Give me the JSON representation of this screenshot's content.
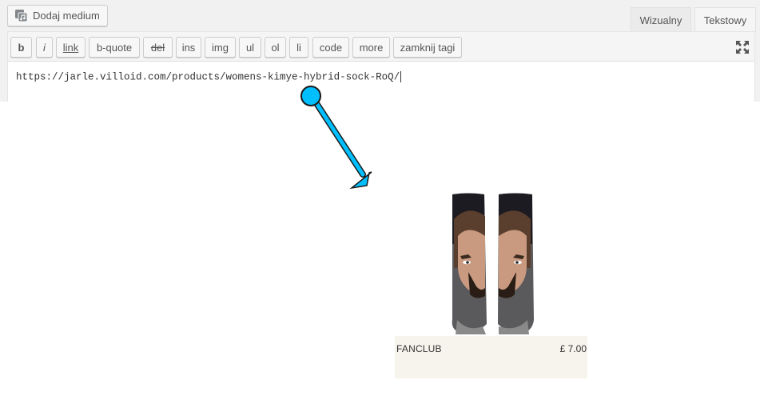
{
  "editor": {
    "add_media_label": "Dodaj medium",
    "tabs": [
      {
        "label": "Wizualny",
        "active": false
      },
      {
        "label": "Tekstowy",
        "active": true
      }
    ],
    "toolbar_buttons": [
      "b",
      "i",
      "link",
      "b-quote",
      "del",
      "ins",
      "img",
      "ul",
      "ol",
      "li",
      "code",
      "more",
      "zamknij tagi"
    ],
    "content_text": "https://jarle.villoid.com/products/womens-kimye-hybrid-sock-RoQ/"
  },
  "preview": {
    "brand": "FANCLUB",
    "price": "£ 7.00"
  },
  "colors": {
    "arrow": "#00bfff",
    "card_bg": "#f7f4ee"
  }
}
